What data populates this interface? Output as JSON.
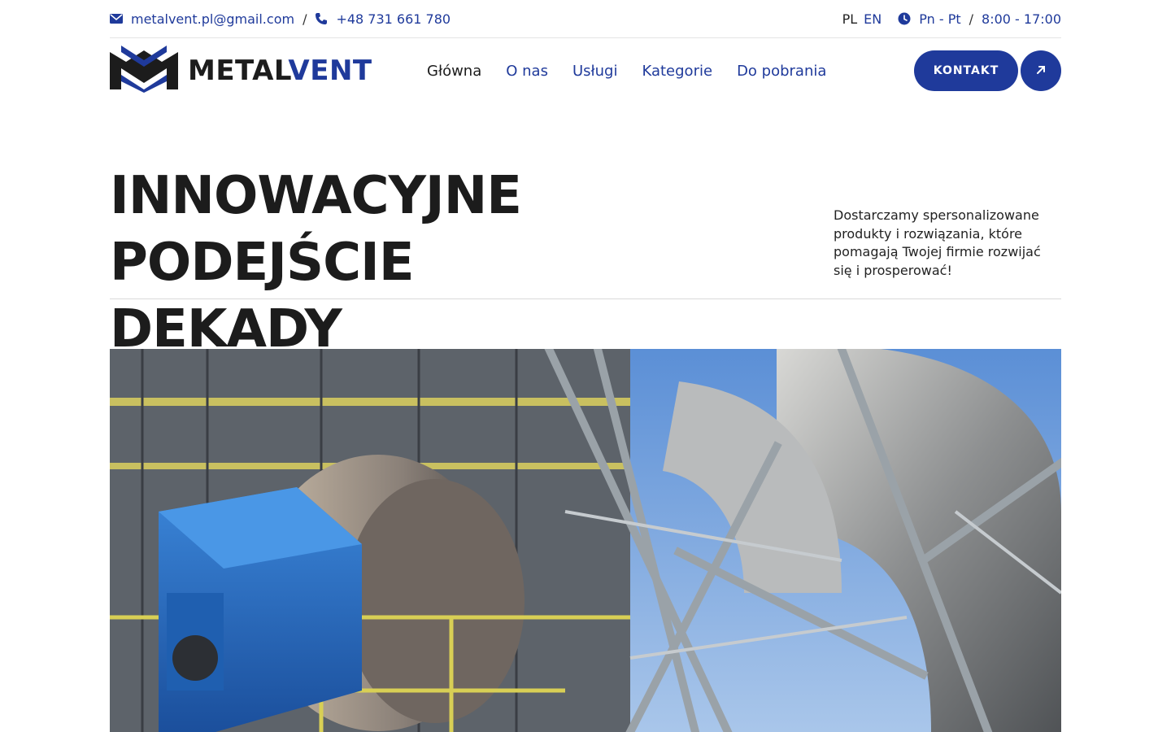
{
  "topbar": {
    "email": "metalvent.pl@gmail.com",
    "separator": "/",
    "phone": "+48 731 661 780",
    "lang_pl": "PL",
    "lang_en": "EN",
    "days": "Pn - Pt",
    "hours": "8:00 - 17:00",
    "icons": {
      "email": "envelope-icon",
      "phone": "phone-icon",
      "clock": "clock-icon"
    }
  },
  "brand": {
    "name_part1": "METAL",
    "name_part2": "VENT",
    "logo_icon": "metalvent-logo-icon"
  },
  "nav": {
    "items": [
      {
        "label": "Główna",
        "active": true
      },
      {
        "label": "O nas"
      },
      {
        "label": "Usługi"
      },
      {
        "label": "Kategorie"
      },
      {
        "label": "Do pobrania"
      }
    ],
    "cta_label": "KONTAKT",
    "cta_icon": "arrow-up-right-icon"
  },
  "hero": {
    "title_line1": "INNOWACYJNE PODEJŚCIE",
    "title_line2": "DEKADY DOŚWIADCZENIA",
    "description": "Dostarczamy spersonalizowane produkty i rozwiązania, które pomagają Twojej firmie rozwijać się i prosperować!"
  },
  "colors": {
    "accent": "#1f3a9b",
    "text": "#1c1c1c"
  }
}
